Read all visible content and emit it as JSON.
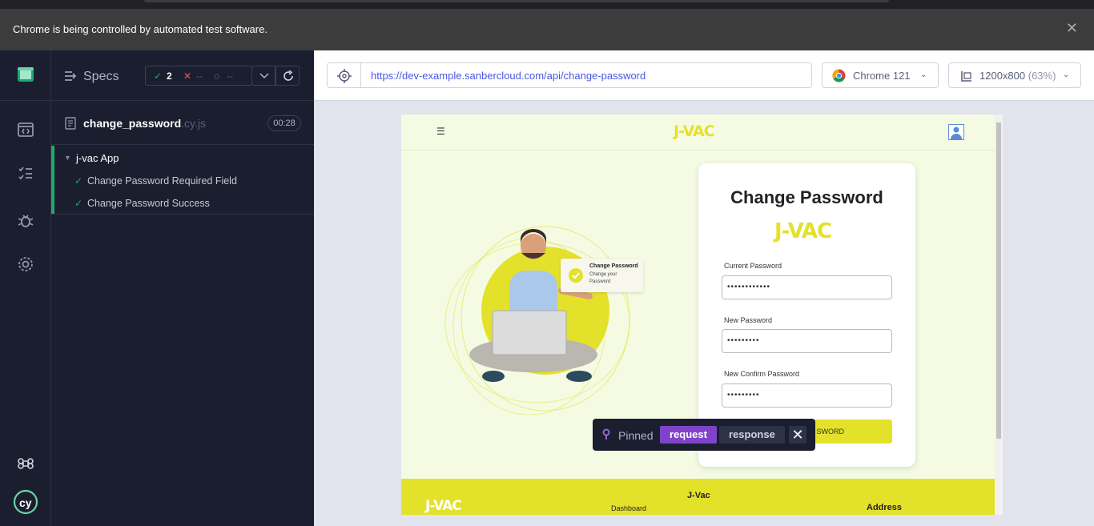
{
  "browser": {
    "infobar_message": "Chrome is being controlled by automated test software."
  },
  "specs_panel": {
    "title": "Specs",
    "passed_count": "2",
    "failed_count": "--",
    "pending_count": "--",
    "file": {
      "name": "change_password",
      "ext": ".cy.js",
      "duration": "00:28"
    },
    "suite": {
      "name": "j-vac App",
      "tests": [
        {
          "label": "Change Password Required Field",
          "status": "passed"
        },
        {
          "label": "Change Password Success",
          "status": "passed"
        }
      ]
    }
  },
  "runner": {
    "url": "https://dev-example.sanbercloud.com/api/change-password",
    "browser_label": "Chrome 121",
    "viewport_label": "1200x800",
    "viewport_scale": "(63%)"
  },
  "app": {
    "brand": "J-VAC",
    "illustration_card_title": "Change Password",
    "illustration_card_sub": "Change your Password",
    "form": {
      "title": "Change Password",
      "fields": [
        {
          "label": "Current Password",
          "value": "••••••••••••"
        },
        {
          "label": "New Password",
          "value": "•••••••••"
        },
        {
          "label": "New Confirm Password",
          "value": "•••••••••"
        }
      ],
      "submit_label": "SWORD"
    },
    "footer": {
      "brand": "J-VAC",
      "title": "J-Vac",
      "link": "Dashboard",
      "address_heading": "Address"
    }
  },
  "pinned": {
    "label": "Pinned",
    "tab_request": "request",
    "tab_response": "response"
  },
  "colors": {
    "cypress_bg": "#1b1e2e",
    "pass_green": "#1fa971",
    "fail_red": "#e45770",
    "app_yellow": "#e4e12b",
    "app_bg": "#f4fbe2",
    "pinned_purple": "#7f43c9"
  }
}
